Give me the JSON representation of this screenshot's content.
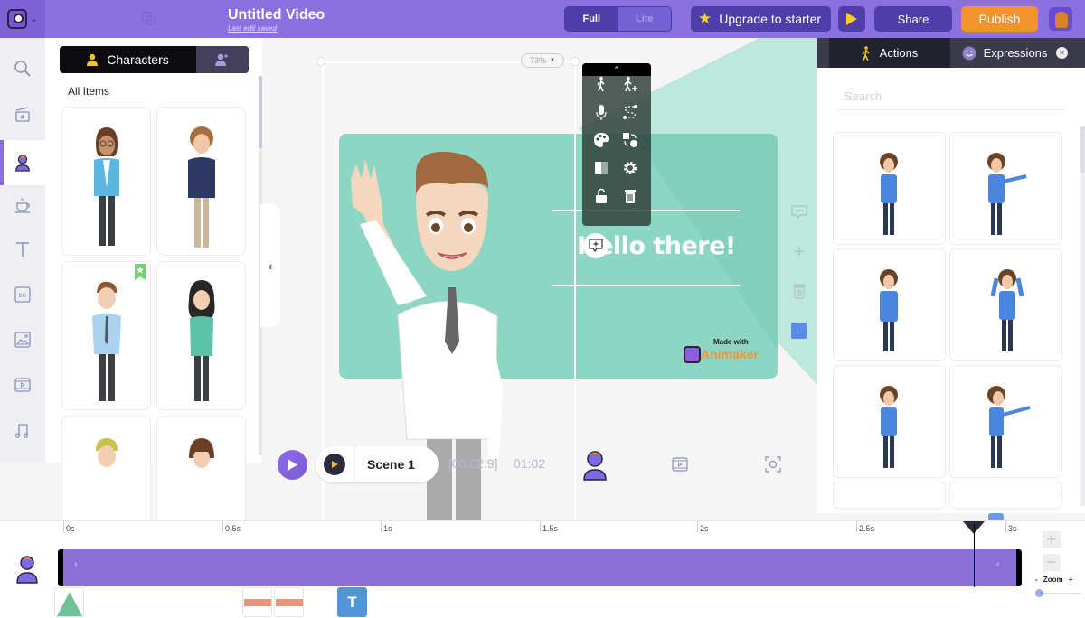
{
  "header": {
    "title": "Untitled Video",
    "subtitle": "Last edit saved",
    "mode_options": [
      "Full",
      "Lite"
    ],
    "mode_selected": "Full",
    "upgrade_label": "Upgrade to starter",
    "share_label": "Share",
    "publish_label": "Publish",
    "icons": [
      "animaker-logo-icon",
      "chevron-down-icon",
      "duplicate-icon",
      "star-icon",
      "play-icon",
      "user-avatar"
    ]
  },
  "rail": {
    "items": [
      {
        "name": "search",
        "icon": "search-icon"
      },
      {
        "name": "templates",
        "icon": "clapperboard-icon"
      },
      {
        "name": "characters",
        "icon": "character-icon",
        "active": true
      },
      {
        "name": "properties",
        "icon": "coffee-cup-icon"
      },
      {
        "name": "text",
        "icon": "text-icon"
      },
      {
        "name": "backgrounds",
        "icon": "bg-icon"
      },
      {
        "name": "images",
        "icon": "image-icon"
      },
      {
        "name": "video",
        "icon": "film-icon"
      },
      {
        "name": "music",
        "icon": "music-note-icon"
      }
    ]
  },
  "library": {
    "tab_characters": "Characters",
    "section_label": "All Items",
    "cards": [
      {
        "name": "woman-glasses-blue-blazer",
        "premium": false
      },
      {
        "name": "man-curly-navy-hoodie",
        "premium": false
      },
      {
        "name": "man-shirt-tie",
        "premium": true
      },
      {
        "name": "woman-curly-teal-shirt",
        "premium": false
      },
      {
        "name": "man-blond",
        "premium": false
      },
      {
        "name": "woman-bangs",
        "premium": false
      }
    ]
  },
  "canvas": {
    "zoom_level": "73%",
    "headline": "Hello there!",
    "watermark_small": "Made with",
    "watermark_big": "Animaker",
    "toolbar_actions": [
      "action-icon",
      "add-action-icon",
      "microphone-icon",
      "path-icon",
      "palette-icon",
      "swap-icon",
      "flip-icon",
      "settings-icon",
      "unlock-icon",
      "trash-icon"
    ],
    "slide_color": "#8dd6c3"
  },
  "scene": {
    "name": "Scene 1",
    "current_time": "[00:02.9]",
    "total_time": "01:02"
  },
  "right_panel": {
    "tab_actions": "Actions",
    "tab_expressions": "Expressions",
    "search_placeholder": "Search",
    "action_cards": [
      "idle",
      "present-right",
      "sad",
      "headache",
      "thinking",
      "present-side"
    ]
  },
  "timeline": {
    "ticks": [
      "0s",
      "0.5s",
      "1s",
      "1.5s",
      "2s",
      "2.5s",
      "3s"
    ],
    "playhead_seconds": 2.9,
    "zoom_label": "- Zoom +",
    "zoom_fraction": 0.0,
    "keyframes": [
      "enter-animation",
      "action-1",
      "action-2",
      "text"
    ],
    "track_color": "#8b70d8"
  },
  "colors": {
    "brand": "#8b70e0",
    "publish": "#f2932b",
    "accent_dark": "#4f3da8"
  }
}
